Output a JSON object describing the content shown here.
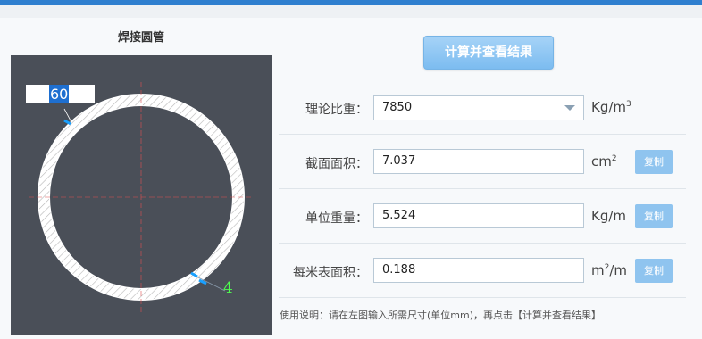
{
  "left": {
    "title": "焊接圆管",
    "diameter_value": "60",
    "thickness_value": "4"
  },
  "calc_button": "计算并查看结果",
  "rows": [
    {
      "label": "理论比重：",
      "value": "7850",
      "unit": "Kg/m",
      "unit_sup": "3"
    },
    {
      "label": "截面面积：",
      "value": "7.037",
      "unit": "cm",
      "unit_sup": "2",
      "copy": "复制"
    },
    {
      "label": "单位重量：",
      "value": "5.524",
      "unit": "Kg/m",
      "copy": "复制"
    },
    {
      "label": "每米表面积：",
      "value": "0.188",
      "unit_pre": "m",
      "unit_sup": "2",
      "unit_post": "/m",
      "copy": "复制"
    }
  ],
  "note": "使用说明：请在左图输入所需尺寸(单位mm)，再点击【计算并查看结果】",
  "colors": {
    "figure_bg": "#4a4f58",
    "button": "#8fc4ef",
    "dimension_highlight": "#1e6fd0",
    "thickness_text": "#4dff4d"
  }
}
